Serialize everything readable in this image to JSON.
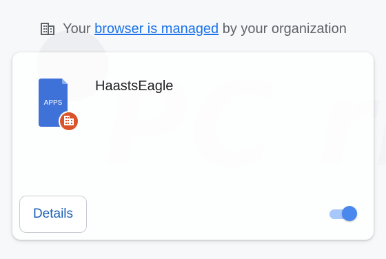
{
  "managed_notice": {
    "prefix": "Your ",
    "link": "browser is managed",
    "suffix": " by your organization"
  },
  "extension": {
    "name": "HaastsEagle",
    "icon_label": "APPS",
    "icon_color": "#3f72d9",
    "badge_color": "#d9542b"
  },
  "actions": {
    "details_label": "Details",
    "enabled": true
  },
  "watermark_text": "PC risk.com"
}
